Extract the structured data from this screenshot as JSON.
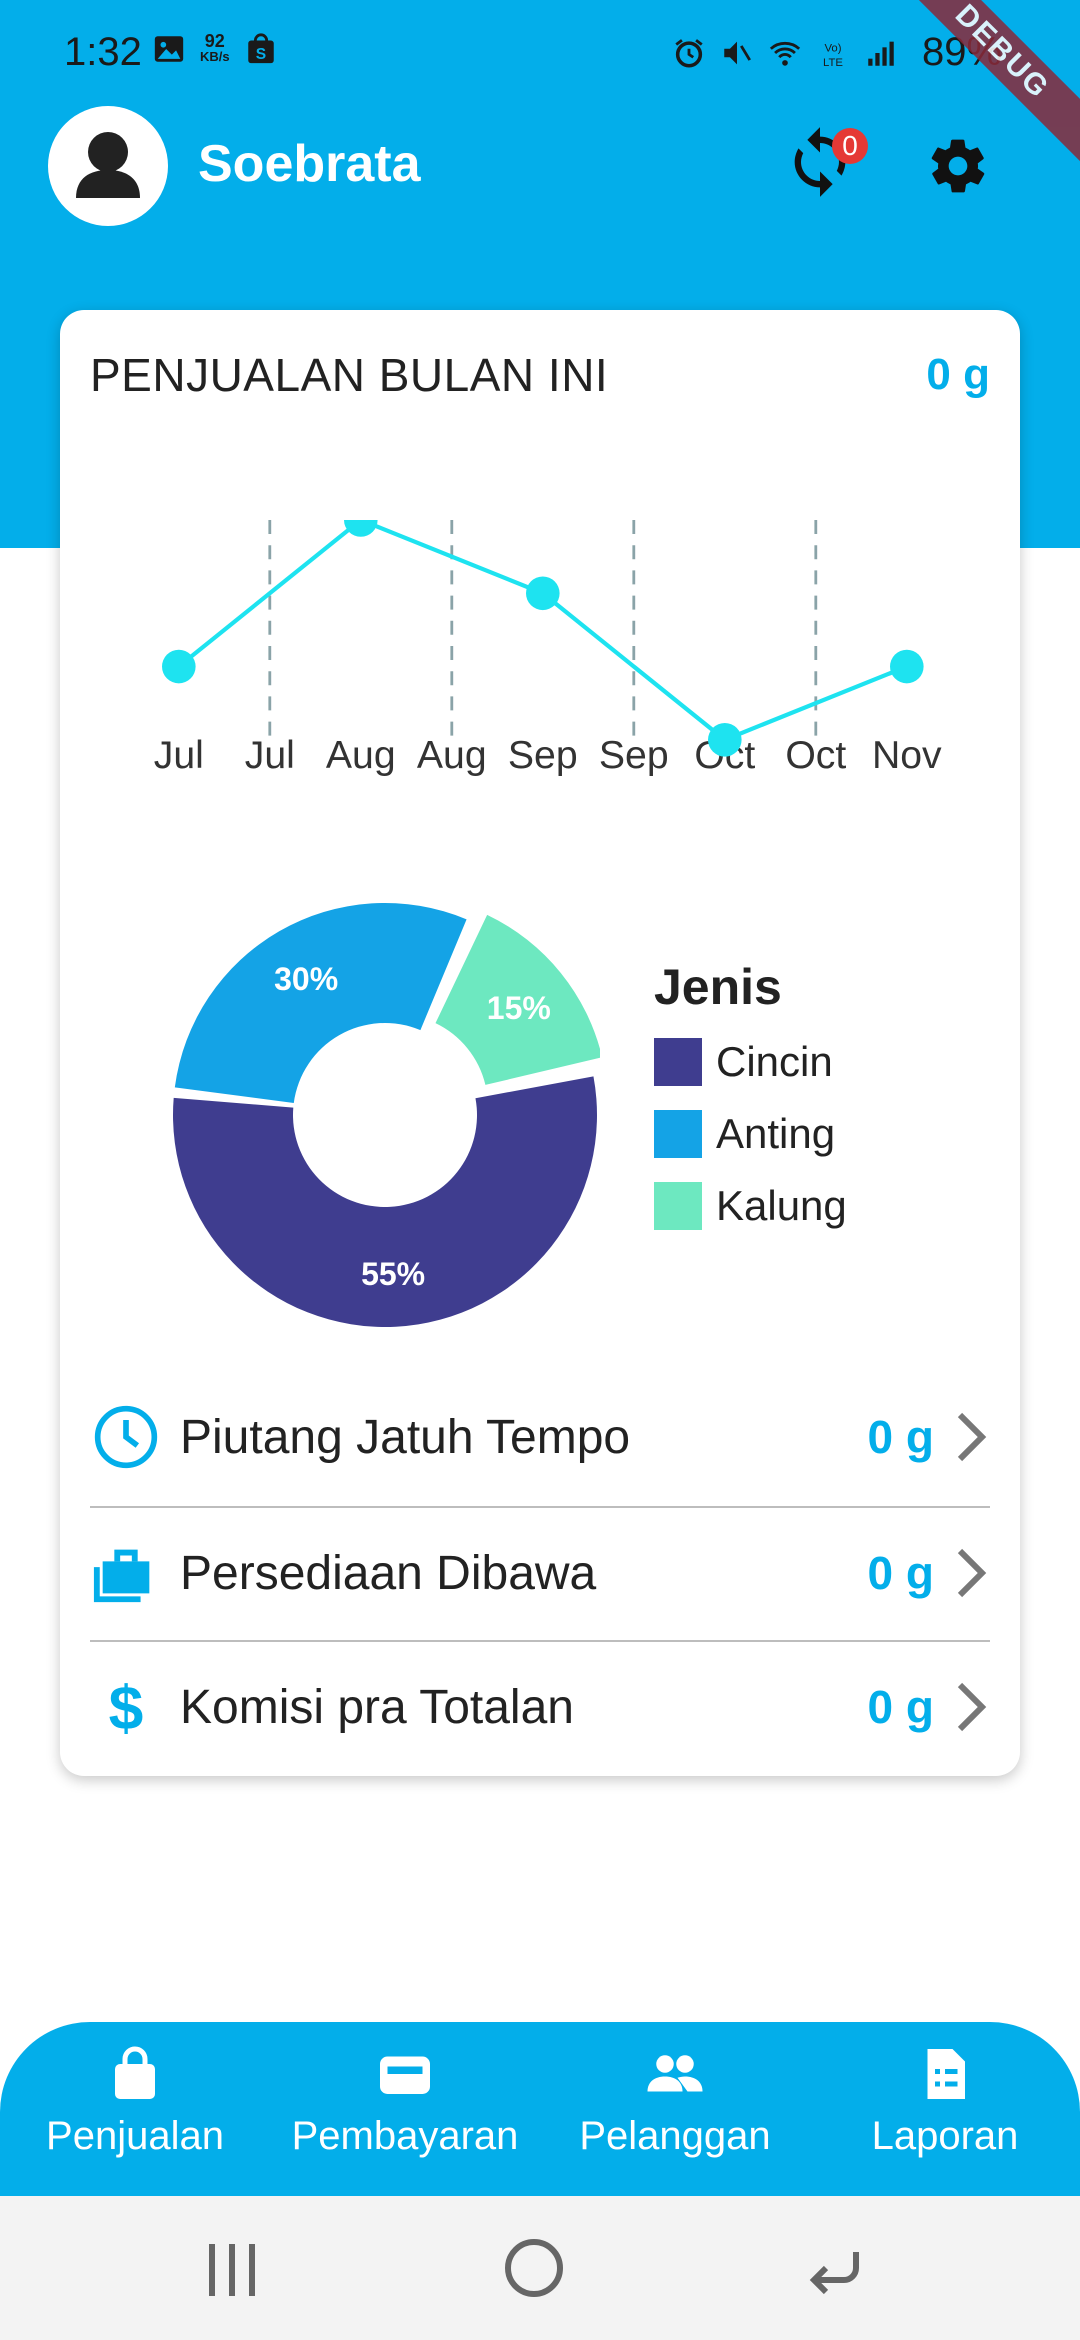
{
  "status_bar": {
    "time": "1:32",
    "net_speed": "92",
    "net_unit": "KB/s",
    "battery": "89%",
    "debug_label": "DEBUG"
  },
  "header": {
    "user_name": "Soebrata",
    "sync_badge": "0"
  },
  "card": {
    "title": "PENJUALAN BULAN INI",
    "total": "0 g"
  },
  "chart_data": [
    {
      "type": "line",
      "x": [
        "Jul",
        "Jul",
        "Aug",
        "Aug",
        "Sep",
        "Sep",
        "Oct",
        "Oct",
        "Nov"
      ],
      "points": [
        {
          "label": "Jul",
          "y": 2
        },
        {
          "label": "Aug",
          "y": 4
        },
        {
          "label": "Sep",
          "y": 3
        },
        {
          "label": "Oct",
          "y": 1
        },
        {
          "label": "Nov",
          "y": 2
        }
      ],
      "ylim": [
        1,
        4
      ],
      "grid": "vertical dashed",
      "color": "#1ee3f0"
    },
    {
      "type": "pie",
      "donut": true,
      "legend_title": "Jenis",
      "legend_position": "right",
      "slices": [
        {
          "name": "Cincin",
          "value": 55,
          "label": "55%",
          "color": "#3f3d8f"
        },
        {
          "name": "Anting",
          "value": 30,
          "label": "30%",
          "color": "#14a3e6"
        },
        {
          "name": "Kalung",
          "value": 15,
          "label": "15%",
          "color": "#6de8c0"
        }
      ]
    }
  ],
  "list": [
    {
      "label": "Piutang Jatuh Tempo",
      "value": "0 g",
      "icon": "clock-icon"
    },
    {
      "label": "Persediaan Dibawa",
      "value": "0 g",
      "icon": "briefcase-icon"
    },
    {
      "label": "Komisi pra Totalan",
      "value": "0 g",
      "icon": "dollar-icon"
    }
  ],
  "bottom_nav": [
    {
      "label": "Penjualan",
      "icon": "shopping-bag-icon"
    },
    {
      "label": "Pembayaran",
      "icon": "wallet-icon"
    },
    {
      "label": "Pelanggan",
      "icon": "people-icon"
    },
    {
      "label": "Laporan",
      "icon": "report-icon"
    }
  ],
  "colors": {
    "primary": "#03aeea",
    "badge": "#e53935"
  }
}
